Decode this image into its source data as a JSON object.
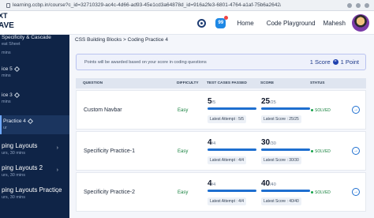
{
  "browser": {
    "url": "learning.ccbp.in/course?c_id=32710329-ac4c-4d66-ad93-45e1cd3a64878d_id=916a2fe3-6801-4764-a1af-75b6a2642ac68s_id=5e9a9460-1f0f-4c..."
  },
  "topnav": {
    "brand_line1": "XT",
    "brand_line2": "AVE",
    "notif_label": "99",
    "home": "Home",
    "playground": "Code Playground",
    "user": "Mahesh"
  },
  "sidebar": {
    "items": [
      {
        "title": "Specificity & Cascade",
        "sub": "eat Sheet"
      },
      {
        "title": "mins",
        "sub": ""
      },
      {
        "title": "ice 5",
        "sub": "mins"
      },
      {
        "title": "ice 3",
        "sub": "mins"
      },
      {
        "title": "Practice 4",
        "sub": "ur"
      },
      {
        "title": "ping Layouts",
        "sub": "urs, 30 mins"
      },
      {
        "title": "ping Layouts 2",
        "sub": "urs, 30 mins"
      },
      {
        "title": "ping Layouts Practice",
        "sub": "urs, 30 mins"
      }
    ]
  },
  "breadcrumb": "CSS Building Blocks > Coding Practice 4",
  "info": {
    "message": "Points will be awarded based on your score in coding questions",
    "score_label": "1 Score",
    "equals": "=",
    "point_label": "1 Point"
  },
  "table": {
    "headers": {
      "question": "QUESTION",
      "difficulty": "DIFFICULTY",
      "tests": "TEST CASES PASSED",
      "score": "SCORE",
      "status": "STATUS"
    },
    "rows": [
      {
        "question": "Custom Navbar",
        "difficulty": "Easy",
        "tests_value": "5",
        "tests_total": "/5",
        "tests_fraction": 1.0,
        "latest_attempt": "Latest Attempt : 5/5",
        "score_value": "25",
        "score_total": "/25",
        "score_fraction": 1.0,
        "latest_score": "Latest Score : 25/25",
        "status": "SOLVED"
      },
      {
        "question": "Specificity Practice-1",
        "difficulty": "Easy",
        "tests_value": "4",
        "tests_total": "/4",
        "tests_fraction": 1.0,
        "latest_attempt": "Latest Attempt : 4/4",
        "score_value": "30",
        "score_total": "/30",
        "score_fraction": 1.0,
        "latest_score": "Latest Score : 30/30",
        "status": "SOLVED"
      },
      {
        "question": "Specificity Practice-2",
        "difficulty": "Easy",
        "tests_value": "4",
        "tests_total": "/4",
        "tests_fraction": 1.0,
        "latest_attempt": "Latest Attempt : 4/4",
        "score_value": "40",
        "score_total": "/40",
        "score_fraction": 1.0,
        "latest_score": "Latest Score : 40/40",
        "status": "SOLVED"
      }
    ]
  }
}
